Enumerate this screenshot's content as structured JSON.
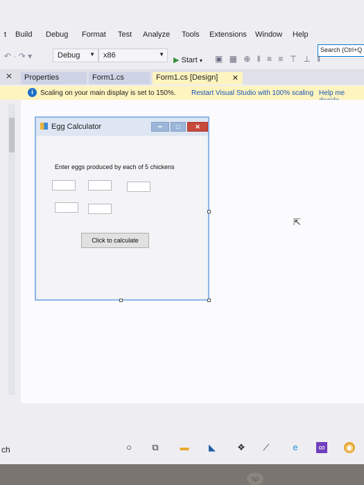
{
  "menu": {
    "items": [
      "t",
      "Build",
      "Debug",
      "Format",
      "Test",
      "Analyze",
      "Tools",
      "Extensions",
      "Window",
      "Help"
    ],
    "search_placeholder": "Search (Ctrl+Q"
  },
  "toolbar": {
    "config": "Debug",
    "platform": "x86",
    "start_label": "Start"
  },
  "tabs": [
    {
      "label": "Properties"
    },
    {
      "label": "Form1.cs"
    },
    {
      "label": "Form1.cs [Design]"
    }
  ],
  "infobar": {
    "message": "Scaling on your main display is set to 150%.",
    "link_restart": "Restart Visual Studio with 100% scaling",
    "link_help": "Help me decide"
  },
  "form": {
    "title": "Egg Calculator",
    "label": "Enter eggs produced by each of 5 chickens",
    "button_label": "Click to calculate"
  },
  "taskbar": {
    "left_text": "ch"
  },
  "colors": {
    "infobar": "#fdf4bf",
    "accent": "#0078d7",
    "close_button": "#c84a3a"
  }
}
